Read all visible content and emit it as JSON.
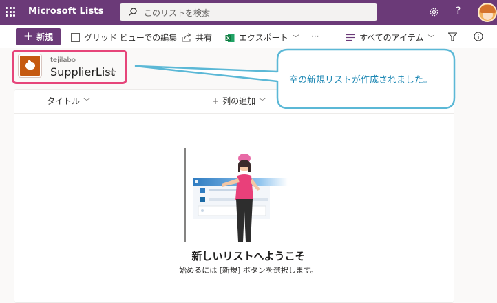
{
  "header": {
    "app_name": "Microsoft Lists",
    "search_placeholder": "このリストを検索",
    "help_glyph": "?"
  },
  "toolbar": {
    "new_label": "新規",
    "grid_edit_label": "グリッド ビューでの編集",
    "share_label": "共有",
    "export_label": "エクスポート",
    "more_glyph": "···",
    "view_label": "すべてのアイテム"
  },
  "list": {
    "site_name": "tejilabo",
    "title": "SupplierList",
    "favorite_glyph": "☆"
  },
  "callout": {
    "text": "空の新規リストが作成されました。"
  },
  "columns": {
    "title_label": "タイトル",
    "add_column_label": "列の追加",
    "add_glyph": "+"
  },
  "empty_state": {
    "title": "新しいリストへようこそ",
    "subtitle": "始めるには [新規] ボタンを選択します。"
  },
  "colors": {
    "suite_bar": "#6b3a78",
    "highlight": "#e6457a",
    "callout_border": "#5bb8d6",
    "callout_text": "#1e88b4",
    "list_icon": "#c55a11"
  },
  "icons": [
    "waffle-icon",
    "search-icon",
    "gear-icon",
    "help-icon",
    "avatar",
    "grid-icon",
    "share-icon",
    "excel-icon",
    "view-lines-icon",
    "filter-icon",
    "info-icon",
    "list-icon",
    "star-icon"
  ]
}
